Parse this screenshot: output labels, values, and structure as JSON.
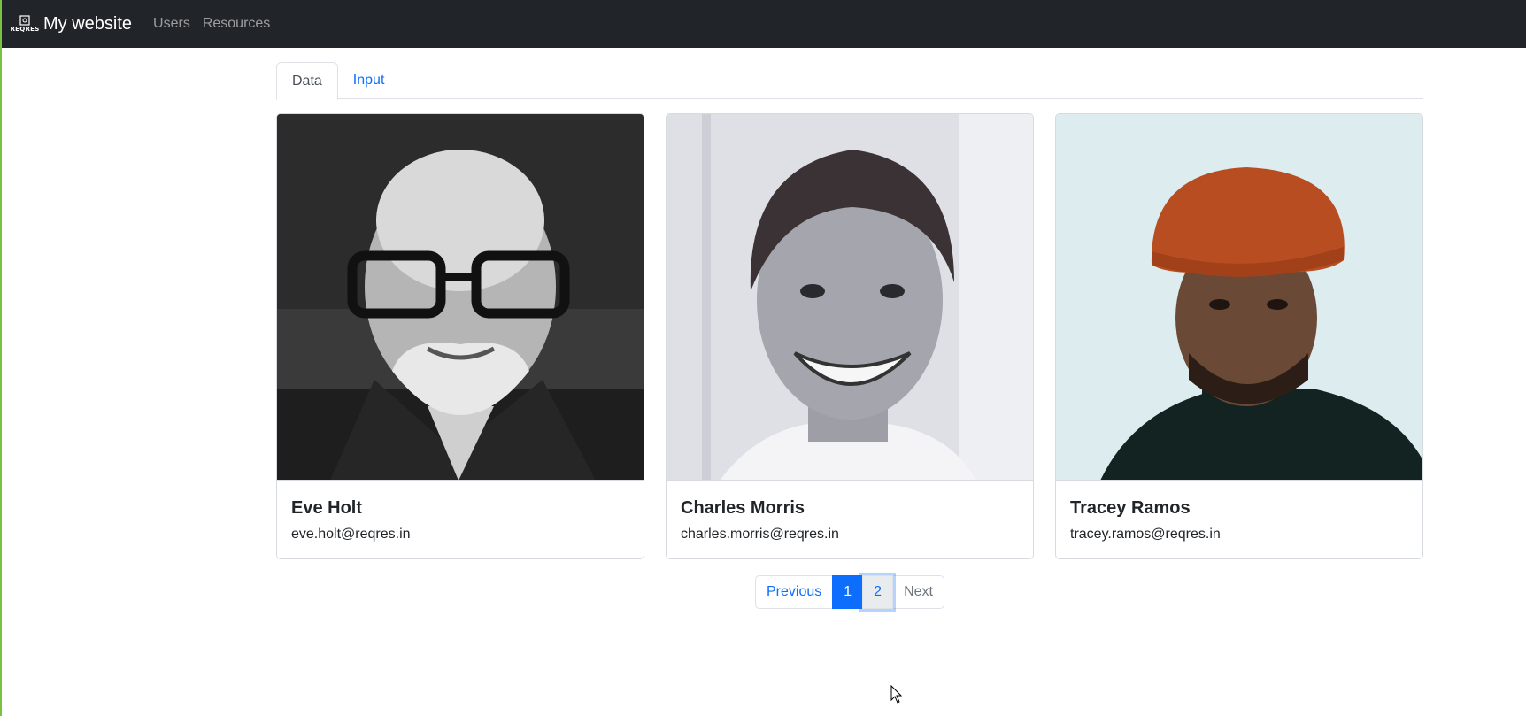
{
  "navbar": {
    "logo_text": "REQRES",
    "brand": "My website",
    "links": [
      "Users",
      "Resources"
    ]
  },
  "tabs": [
    {
      "label": "Data",
      "active": true
    },
    {
      "label": "Input",
      "active": false
    }
  ],
  "users": [
    {
      "name": "Eve Holt",
      "email": "eve.holt@reqres.in"
    },
    {
      "name": "Charles Morris",
      "email": "charles.morris@reqres.in"
    },
    {
      "name": "Tracey Ramos",
      "email": "tracey.ramos@reqres.in"
    }
  ],
  "pagination": {
    "previous": "Previous",
    "pages": [
      "1",
      "2"
    ],
    "active_page": "1",
    "next": "Next"
  },
  "colors": {
    "navbar_bg": "#212529",
    "link": "#0d6efd",
    "active_page_bg": "#0d6efd",
    "left_accent": "#7ac142"
  }
}
